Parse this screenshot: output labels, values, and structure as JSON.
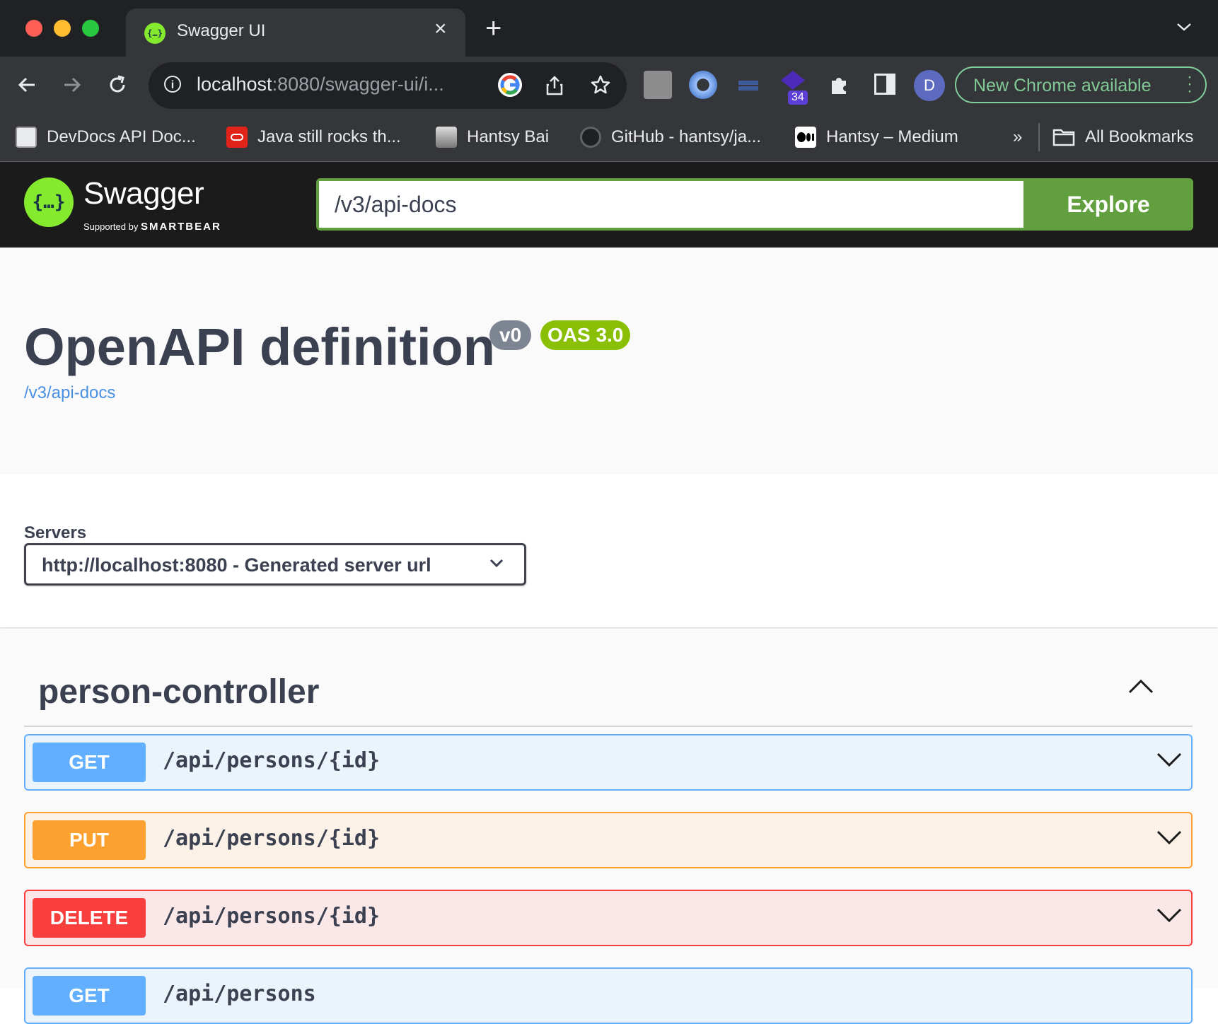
{
  "browser": {
    "tab": {
      "title": "Swagger UI"
    },
    "address": {
      "host": "localhost",
      "rest": ":8080/swagger-ui/i..."
    },
    "extensions_badge": "34",
    "profile_initial": "D",
    "update_label": "New Chrome available",
    "bookmarks": [
      {
        "label": "DevDocs API Doc...",
        "icon": "devdocs-icon"
      },
      {
        "label": "Java still rocks th...",
        "icon": "oracle-icon"
      },
      {
        "label": "Hantsy Bai",
        "icon": "portrait-icon"
      },
      {
        "label": "GitHub - hantsy/ja...",
        "icon": "github-icon"
      },
      {
        "label": "Hantsy – Medium",
        "icon": "medium-icon"
      }
    ],
    "bookmarks_overflow": "»",
    "all_bookmarks": "All Bookmarks"
  },
  "swagger": {
    "brand": "Swagger",
    "supported_by": "Supported by",
    "smartbear": "SMARTBEAR",
    "spec_url": "/v3/api-docs",
    "explore_label": "Explore"
  },
  "info": {
    "title": "OpenAPI definition",
    "version": "v0",
    "oas": "OAS 3.0",
    "link": "/v3/api-docs"
  },
  "servers": {
    "label": "Servers",
    "selected": "http://localhost:8080 - Generated server url"
  },
  "controller": {
    "name": "person-controller",
    "operations": [
      {
        "method": "GET",
        "path": "/api/persons/{id}",
        "color": "#61affe"
      },
      {
        "method": "PUT",
        "path": "/api/persons/{id}",
        "color": "#fca130"
      },
      {
        "method": "DELETE",
        "path": "/api/persons/{id}",
        "color": "#f93e3e"
      },
      {
        "method": "GET",
        "path": "/api/persons",
        "color": "#61affe"
      }
    ]
  },
  "colors": {
    "swagger_green": "#85ea2d",
    "explore_green": "#62a03f",
    "oas_badge": "#89bf04",
    "version_badge": "#7d8492"
  }
}
